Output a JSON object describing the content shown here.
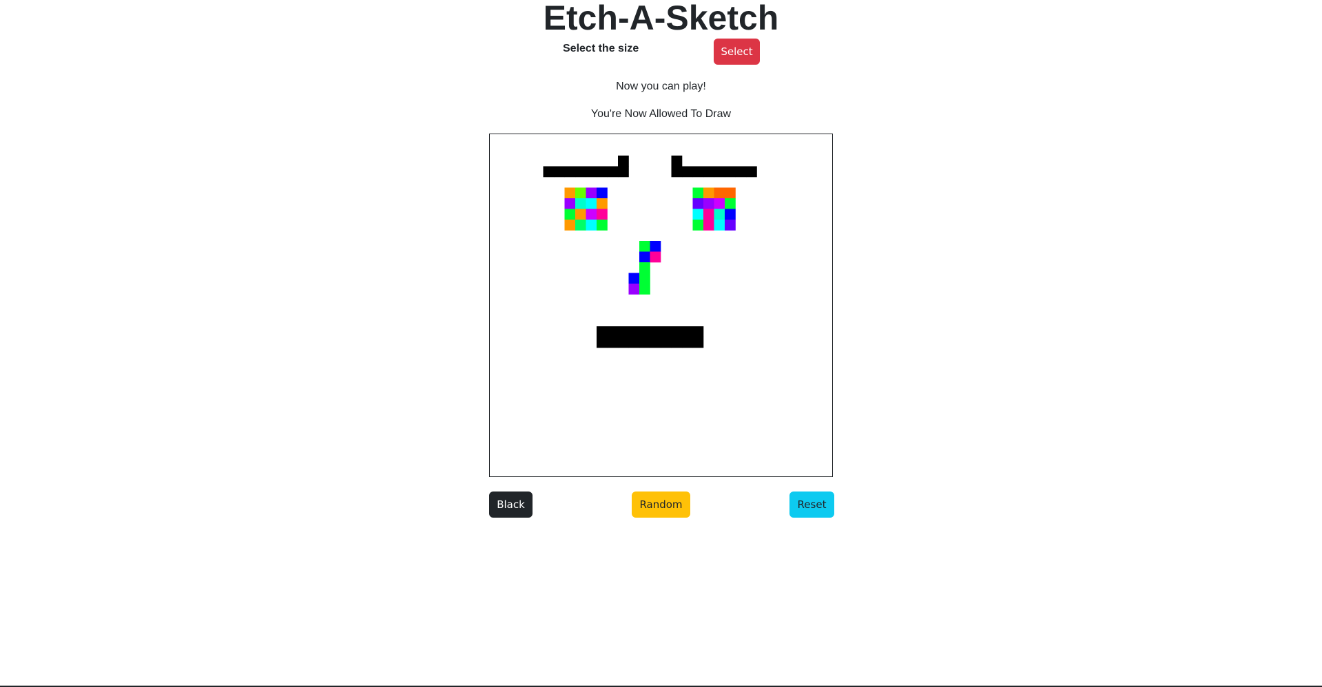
{
  "app": {
    "title": "Etch-A-Sketch"
  },
  "controls": {
    "size_label": "Select the size",
    "select_button": "Select"
  },
  "status": {
    "play_message": "Now you can play!",
    "draw_message": "You're Now Allowed To Draw"
  },
  "board": {
    "grid_size": 32,
    "background": "#ffffff",
    "cells": [
      {
        "r": 2,
        "c": 12,
        "color": "#000000"
      },
      {
        "r": 2,
        "c": 17,
        "color": "#000000"
      },
      {
        "r": 3,
        "c": 5,
        "color": "#000000"
      },
      {
        "r": 3,
        "c": 6,
        "color": "#000000"
      },
      {
        "r": 3,
        "c": 7,
        "color": "#000000"
      },
      {
        "r": 3,
        "c": 8,
        "color": "#000000"
      },
      {
        "r": 3,
        "c": 9,
        "color": "#000000"
      },
      {
        "r": 3,
        "c": 10,
        "color": "#000000"
      },
      {
        "r": 3,
        "c": 11,
        "color": "#000000"
      },
      {
        "r": 3,
        "c": 12,
        "color": "#000000"
      },
      {
        "r": 3,
        "c": 17,
        "color": "#000000"
      },
      {
        "r": 3,
        "c": 18,
        "color": "#000000"
      },
      {
        "r": 3,
        "c": 19,
        "color": "#000000"
      },
      {
        "r": 3,
        "c": 20,
        "color": "#000000"
      },
      {
        "r": 3,
        "c": 21,
        "color": "#000000"
      },
      {
        "r": 3,
        "c": 22,
        "color": "#000000"
      },
      {
        "r": 3,
        "c": 23,
        "color": "#000000"
      },
      {
        "r": 3,
        "c": 24,
        "color": "#000000"
      },
      {
        "r": 5,
        "c": 7,
        "color": "#ff9900"
      },
      {
        "r": 5,
        "c": 8,
        "color": "#66ff00"
      },
      {
        "r": 5,
        "c": 9,
        "color": "#9900ff"
      },
      {
        "r": 5,
        "c": 10,
        "color": "#0000ff"
      },
      {
        "r": 6,
        "c": 7,
        "color": "#9900ff"
      },
      {
        "r": 6,
        "c": 8,
        "color": "#00ffcc"
      },
      {
        "r": 6,
        "c": 9,
        "color": "#00ffff"
      },
      {
        "r": 6,
        "c": 10,
        "color": "#ff9900"
      },
      {
        "r": 7,
        "c": 7,
        "color": "#00ff33"
      },
      {
        "r": 7,
        "c": 8,
        "color": "#ff9900"
      },
      {
        "r": 7,
        "c": 9,
        "color": "#cc00ff"
      },
      {
        "r": 7,
        "c": 10,
        "color": "#ff0099"
      },
      {
        "r": 8,
        "c": 7,
        "color": "#ff9900"
      },
      {
        "r": 8,
        "c": 8,
        "color": "#00ff66"
      },
      {
        "r": 8,
        "c": 9,
        "color": "#00ffff"
      },
      {
        "r": 8,
        "c": 10,
        "color": "#00ff33"
      },
      {
        "r": 5,
        "c": 19,
        "color": "#00ff33"
      },
      {
        "r": 5,
        "c": 20,
        "color": "#ff9900"
      },
      {
        "r": 5,
        "c": 21,
        "color": "#ff6600"
      },
      {
        "r": 5,
        "c": 22,
        "color": "#ff6600"
      },
      {
        "r": 6,
        "c": 19,
        "color": "#6600ff"
      },
      {
        "r": 6,
        "c": 20,
        "color": "#9900ff"
      },
      {
        "r": 6,
        "c": 21,
        "color": "#cc00ff"
      },
      {
        "r": 6,
        "c": 22,
        "color": "#00ff33"
      },
      {
        "r": 7,
        "c": 19,
        "color": "#00ffff"
      },
      {
        "r": 7,
        "c": 20,
        "color": "#ff0099"
      },
      {
        "r": 7,
        "c": 21,
        "color": "#00ffcc"
      },
      {
        "r": 7,
        "c": 22,
        "color": "#0000ff"
      },
      {
        "r": 8,
        "c": 19,
        "color": "#00ff33"
      },
      {
        "r": 8,
        "c": 20,
        "color": "#ff0099"
      },
      {
        "r": 8,
        "c": 21,
        "color": "#00ffff"
      },
      {
        "r": 8,
        "c": 22,
        "color": "#6600ff"
      },
      {
        "r": 10,
        "c": 14,
        "color": "#00ff33"
      },
      {
        "r": 10,
        "c": 15,
        "color": "#0000ff"
      },
      {
        "r": 11,
        "c": 14,
        "color": "#0000ff"
      },
      {
        "r": 11,
        "c": 15,
        "color": "#ff0099"
      },
      {
        "r": 12,
        "c": 14,
        "color": "#00ff33"
      },
      {
        "r": 13,
        "c": 13,
        "color": "#0000ff"
      },
      {
        "r": 13,
        "c": 14,
        "color": "#00ff33"
      },
      {
        "r": 14,
        "c": 13,
        "color": "#9900ff"
      },
      {
        "r": 14,
        "c": 14,
        "color": "#00ff33"
      },
      {
        "r": 18,
        "c": 10,
        "color": "#000000"
      },
      {
        "r": 18,
        "c": 11,
        "color": "#000000"
      },
      {
        "r": 18,
        "c": 12,
        "color": "#000000"
      },
      {
        "r": 18,
        "c": 13,
        "color": "#000000"
      },
      {
        "r": 18,
        "c": 14,
        "color": "#000000"
      },
      {
        "r": 18,
        "c": 15,
        "color": "#000000"
      },
      {
        "r": 18,
        "c": 16,
        "color": "#000000"
      },
      {
        "r": 18,
        "c": 17,
        "color": "#000000"
      },
      {
        "r": 18,
        "c": 18,
        "color": "#000000"
      },
      {
        "r": 18,
        "c": 19,
        "color": "#000000"
      },
      {
        "r": 19,
        "c": 10,
        "color": "#000000"
      },
      {
        "r": 19,
        "c": 11,
        "color": "#000000"
      },
      {
        "r": 19,
        "c": 12,
        "color": "#000000"
      },
      {
        "r": 19,
        "c": 13,
        "color": "#000000"
      },
      {
        "r": 19,
        "c": 14,
        "color": "#000000"
      },
      {
        "r": 19,
        "c": 15,
        "color": "#000000"
      },
      {
        "r": 19,
        "c": 16,
        "color": "#000000"
      },
      {
        "r": 19,
        "c": 17,
        "color": "#000000"
      },
      {
        "r": 19,
        "c": 18,
        "color": "#000000"
      },
      {
        "r": 19,
        "c": 19,
        "color": "#000000"
      }
    ]
  },
  "actions": {
    "black_button": "Black",
    "random_button": "Random",
    "reset_button": "Reset"
  },
  "colors": {
    "select_button": "#dc3545",
    "black_button": "#212529",
    "random_button": "#ffc107",
    "reset_button": "#0dcaf0",
    "board_border": "#212529"
  }
}
